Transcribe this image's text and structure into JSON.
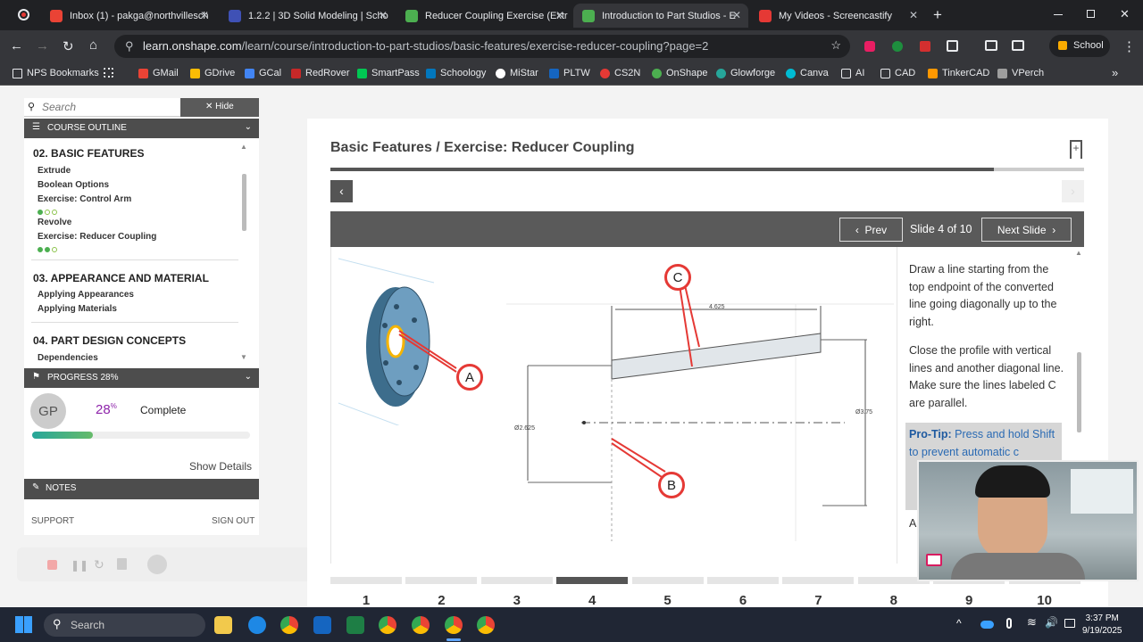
{
  "browser": {
    "tabs": [
      {
        "title": "Inbox (1) - pakga@northvillesch",
        "color": "#ea4335"
      },
      {
        "title": "1.2.2 | 3D Solid Modeling | Scho",
        "color": "#3f51b5"
      },
      {
        "title": "Reducer Coupling Exercise (Extr",
        "color": "#4caf50"
      },
      {
        "title": "Introduction to Part Studios - E",
        "color": "#4caf50"
      },
      {
        "title": "My Videos - Screencastify",
        "color": "#e53935"
      }
    ],
    "url_host": "learn.onshape.com",
    "url_path": "/learn/course/introduction-to-part-studios/basic-features/exercise-reducer-coupling?page=2",
    "profile_label": "School",
    "bookmarks": [
      "NPS Bookmarks",
      "GMail",
      "GDrive",
      "GCal",
      "RedRover",
      "SmartPass",
      "Schoology",
      "MiStar",
      "PLTW",
      "CS2N",
      "OnShape",
      "Glowforge",
      "Canva",
      "AI",
      "CAD",
      "TinkerCAD",
      "VPerch"
    ]
  },
  "sidebar": {
    "search_placeholder": "Search",
    "hide_label": "Hide",
    "outline_label": "COURSE OUTLINE",
    "modules": [
      {
        "title": "02. BASIC FEATURES",
        "lessons": [
          "Extrude",
          "Boolean Options",
          "Exercise: Control Arm",
          "Revolve",
          "Exercise: Reducer Coupling"
        ]
      },
      {
        "title": "03. APPEARANCE AND MATERIAL",
        "lessons": [
          "Applying Appearances",
          "Applying Materials"
        ]
      },
      {
        "title": "04. PART DESIGN CONCEPTS",
        "lessons": [
          "Dependencies"
        ]
      }
    ],
    "progress_label": "PROGRESS 28%",
    "initials": "GP",
    "percent": "28",
    "percent_sign": "%",
    "progress_fraction": 0.28,
    "complete_label": "Complete",
    "show_details": "Show Details",
    "notes_label": "NOTES",
    "support": "SUPPORT",
    "sign_out": "SIGN OUT"
  },
  "content": {
    "breadcrumb": "Basic Features / Exercise: Reducer Coupling",
    "prev_label": "Prev",
    "slide_counter": "Slide 4 of 10",
    "next_label": "Next Slide",
    "instructions_p1": "Draw a line starting from the top endpoint of the converted line going diagonally up to the right.",
    "instructions_p2": "Close the profile with vertical lines and another diagonal line. Make sure the lines labeled C are parallel.",
    "protip_label": "Pro-Tip:",
    "protip_text": "Press and hold Shift to prevent automatic c",
    "partial_text": "A",
    "callouts": {
      "a": "A",
      "b": "B",
      "c": "C"
    },
    "dims": {
      "top": "4.625",
      "left": "Ø2.625",
      "right": "Ø3.75"
    },
    "pages": [
      "1",
      "2",
      "3",
      "4",
      "5",
      "6",
      "7",
      "8",
      "9",
      "10"
    ],
    "current_page": 4
  },
  "taskbar": {
    "search_label": "Search",
    "time": "3:37 PM",
    "date": "9/19/2025"
  }
}
